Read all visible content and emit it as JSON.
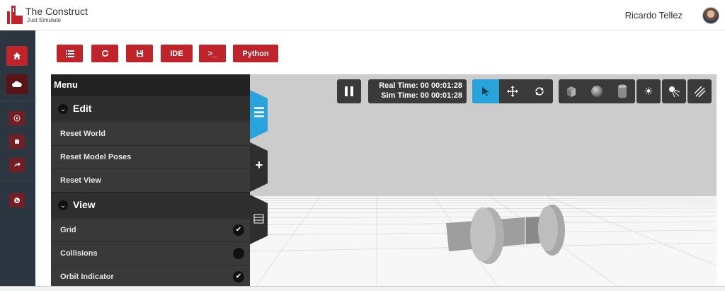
{
  "header": {
    "brand_title": "The Construct",
    "brand_subtitle": "Just Simulate",
    "user_name": "Ricardo Tellez"
  },
  "sidebar": {
    "items": [
      {
        "name": "home-icon",
        "glyph": "⌂"
      },
      {
        "name": "cloud-icon",
        "glyph": "☁"
      },
      {
        "name": "play-icon",
        "glyph": "▶"
      },
      {
        "name": "stop-icon",
        "glyph": "■"
      },
      {
        "name": "share-icon",
        "glyph": "➦"
      },
      {
        "name": "globe-icon",
        "glyph": "◉"
      }
    ]
  },
  "toolbar": {
    "list_icon": "list-icon",
    "reload_icon": "refresh-icon",
    "save_icon": "floppy-icon",
    "ide_label": "IDE",
    "terminal_label": ">_",
    "python_label": "Python"
  },
  "menu": {
    "title": "Menu",
    "sections": [
      {
        "label": "Edit",
        "items": [
          {
            "label": "Reset World"
          },
          {
            "label": "Reset Model Poses"
          },
          {
            "label": "Reset View"
          }
        ]
      },
      {
        "label": "View",
        "items": [
          {
            "label": "Grid",
            "checked": true
          },
          {
            "label": "Collisions",
            "checked": false
          },
          {
            "label": "Orbit Indicator",
            "checked": true
          }
        ]
      }
    ]
  },
  "sim": {
    "real_time": "Real Time: 00 00:01:28",
    "sim_time": "Sim Time: 00 00:01:28",
    "active_mode": "select"
  },
  "colors": {
    "accent_red": "#c0242a",
    "accent_blue": "#29a3dc",
    "panel_dark": "#393939"
  }
}
